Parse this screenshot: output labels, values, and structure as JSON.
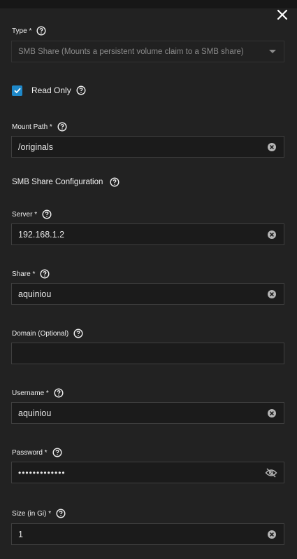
{
  "close_icon": "close-icon",
  "type_field": {
    "label": "Type *",
    "value": "SMB Share (Mounts a persistent volume claim to a SMB share)"
  },
  "read_only": {
    "label": "Read Only",
    "checked": true
  },
  "mount_path": {
    "label": "Mount Path *",
    "value": "/originals"
  },
  "smb_section": {
    "title": "SMB Share Configuration"
  },
  "server": {
    "label": "Server *",
    "value": "192.168.1.2"
  },
  "share": {
    "label": "Share *",
    "value": "aquiniou"
  },
  "domain": {
    "label": "Domain (Optional)",
    "value": ""
  },
  "username": {
    "label": "Username *",
    "value": "aquiniou"
  },
  "password": {
    "label": "Password *",
    "value": "•••••••••••••"
  },
  "size": {
    "label": "Size (in Gi) *",
    "value": "1"
  },
  "colors": {
    "background": "#222222",
    "accent": "#1e88c9",
    "border": "#3f3f3f"
  }
}
